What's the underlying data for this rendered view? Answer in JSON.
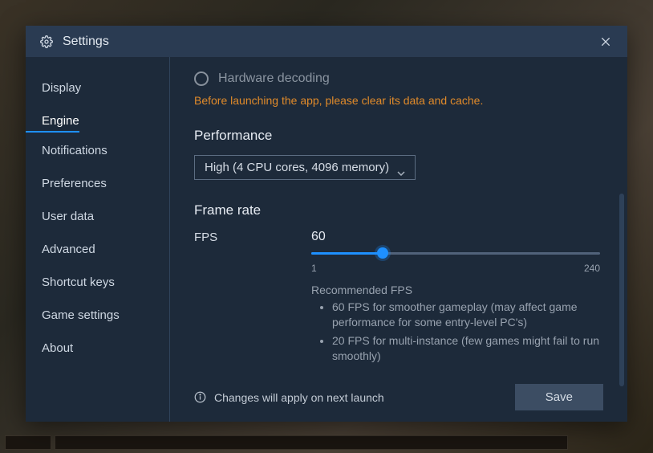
{
  "header": {
    "title": "Settings"
  },
  "sidebar": {
    "items": [
      {
        "label": "Display"
      },
      {
        "label": "Engine",
        "active": true
      },
      {
        "label": "Notifications"
      },
      {
        "label": "Preferences"
      },
      {
        "label": "User data"
      },
      {
        "label": "Advanced"
      },
      {
        "label": "Shortcut keys"
      },
      {
        "label": "Game settings"
      },
      {
        "label": "About"
      }
    ]
  },
  "content": {
    "hardware_decoding_label": "Hardware decoding",
    "warning_text": "Before launching the app, please clear its data and cache.",
    "performance_title": "Performance",
    "performance_value": "High (4 CPU cores, 4096 memory)",
    "frame_rate_title": "Frame rate",
    "fps_label": "FPS",
    "fps_value": "60",
    "slider_min": "1",
    "slider_max": "240",
    "slider_percent": 24.7,
    "reco_title": "Recommended FPS",
    "reco_items": [
      "60 FPS for smoother gameplay (may affect game performance for some entry-level PC's)",
      "20 FPS for multi-instance (few games might fail to run smoothly)"
    ]
  },
  "footer": {
    "notice": "Changes will apply on next launch",
    "save_label": "Save"
  }
}
